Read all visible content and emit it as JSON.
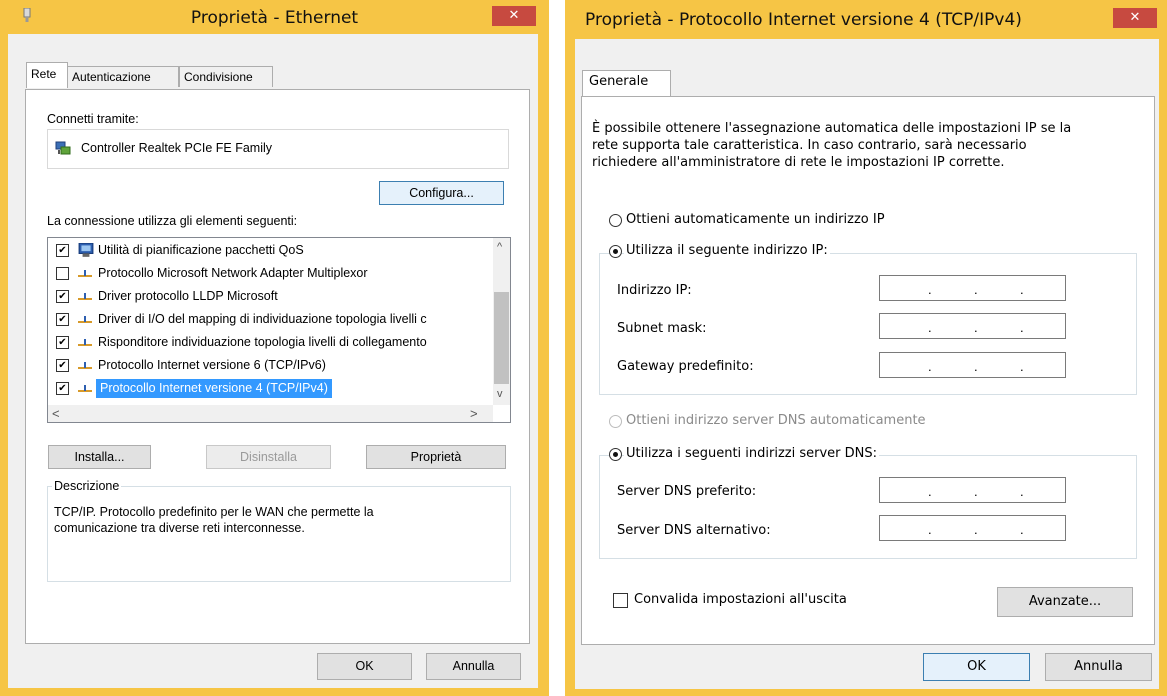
{
  "left_window": {
    "title": "Proprietà - Ethernet",
    "close": "✕",
    "tabs": [
      "Rete",
      "Autenticazione",
      "Condivisione"
    ],
    "connect_label": "Connetti tramite:",
    "adapter": "Controller Realtek PCIe FE Family",
    "configure_button": "Configura...",
    "items_label": "La connessione utilizza gli elementi seguenti:",
    "items": [
      {
        "label": "Utilità di pianificazione pacchetti QoS",
        "checked": true
      },
      {
        "label": "Protocollo Microsoft Network Adapter Multiplexor",
        "checked": false
      },
      {
        "label": "Driver protocollo LLDP Microsoft",
        "checked": true
      },
      {
        "label": "Driver di I/O del mapping di individuazione topologia livelli c",
        "checked": true
      },
      {
        "label": "Risponditore individuazione topologia livelli di collegamento",
        "checked": true
      },
      {
        "label": "Protocollo Internet versione 6 (TCP/IPv6)",
        "checked": true
      },
      {
        "label": "Protocollo Internet versione 4 (TCP/IPv4)",
        "checked": true
      }
    ],
    "install_button": "Installa...",
    "uninstall_button": "Disinstalla",
    "properties_button": "Proprietà",
    "description_title": "Descrizione",
    "description_text_1": "TCP/IP. Protocollo predefinito per le WAN che permette la",
    "description_text_2": "comunicazione tra diverse reti interconnesse.",
    "ok_button": "OK",
    "cancel_button": "Annulla"
  },
  "right_window": {
    "title": "Proprietà - Protocollo Internet versione 4 (TCP/IPv4)",
    "close": "✕",
    "tab": "Generale",
    "intro_1": "È possibile ottenere l'assegnazione automatica delle impostazioni IP se la",
    "intro_2": "rete supporta tale caratteristica. In caso contrario, sarà necessario",
    "intro_3": "richiedere all'amministratore di rete le impostazioni IP corrette.",
    "radio_auto_ip": "Ottieni automaticamente un indirizzo IP",
    "radio_manual_ip": "Utilizza il seguente indirizzo IP:",
    "ip_label": "Indirizzo IP:",
    "subnet_label": "Subnet mask:",
    "gateway_label": "Gateway predefinito:",
    "radio_auto_dns": "Ottieni indirizzo server DNS automaticamente",
    "radio_manual_dns": "Utilizza i seguenti indirizzi server DNS:",
    "dns_pref_label": "Server DNS preferito:",
    "dns_alt_label": "Server DNS alternativo:",
    "validate_label": "Convalida impostazioni all'uscita",
    "advanced_button": "Avanzate...",
    "ok_button": "OK",
    "cancel_button": "Annulla",
    "ip_dot": "."
  },
  "colors": {
    "frame": "#f6c545",
    "close": "#c74a40",
    "selection": "#3399ff"
  }
}
